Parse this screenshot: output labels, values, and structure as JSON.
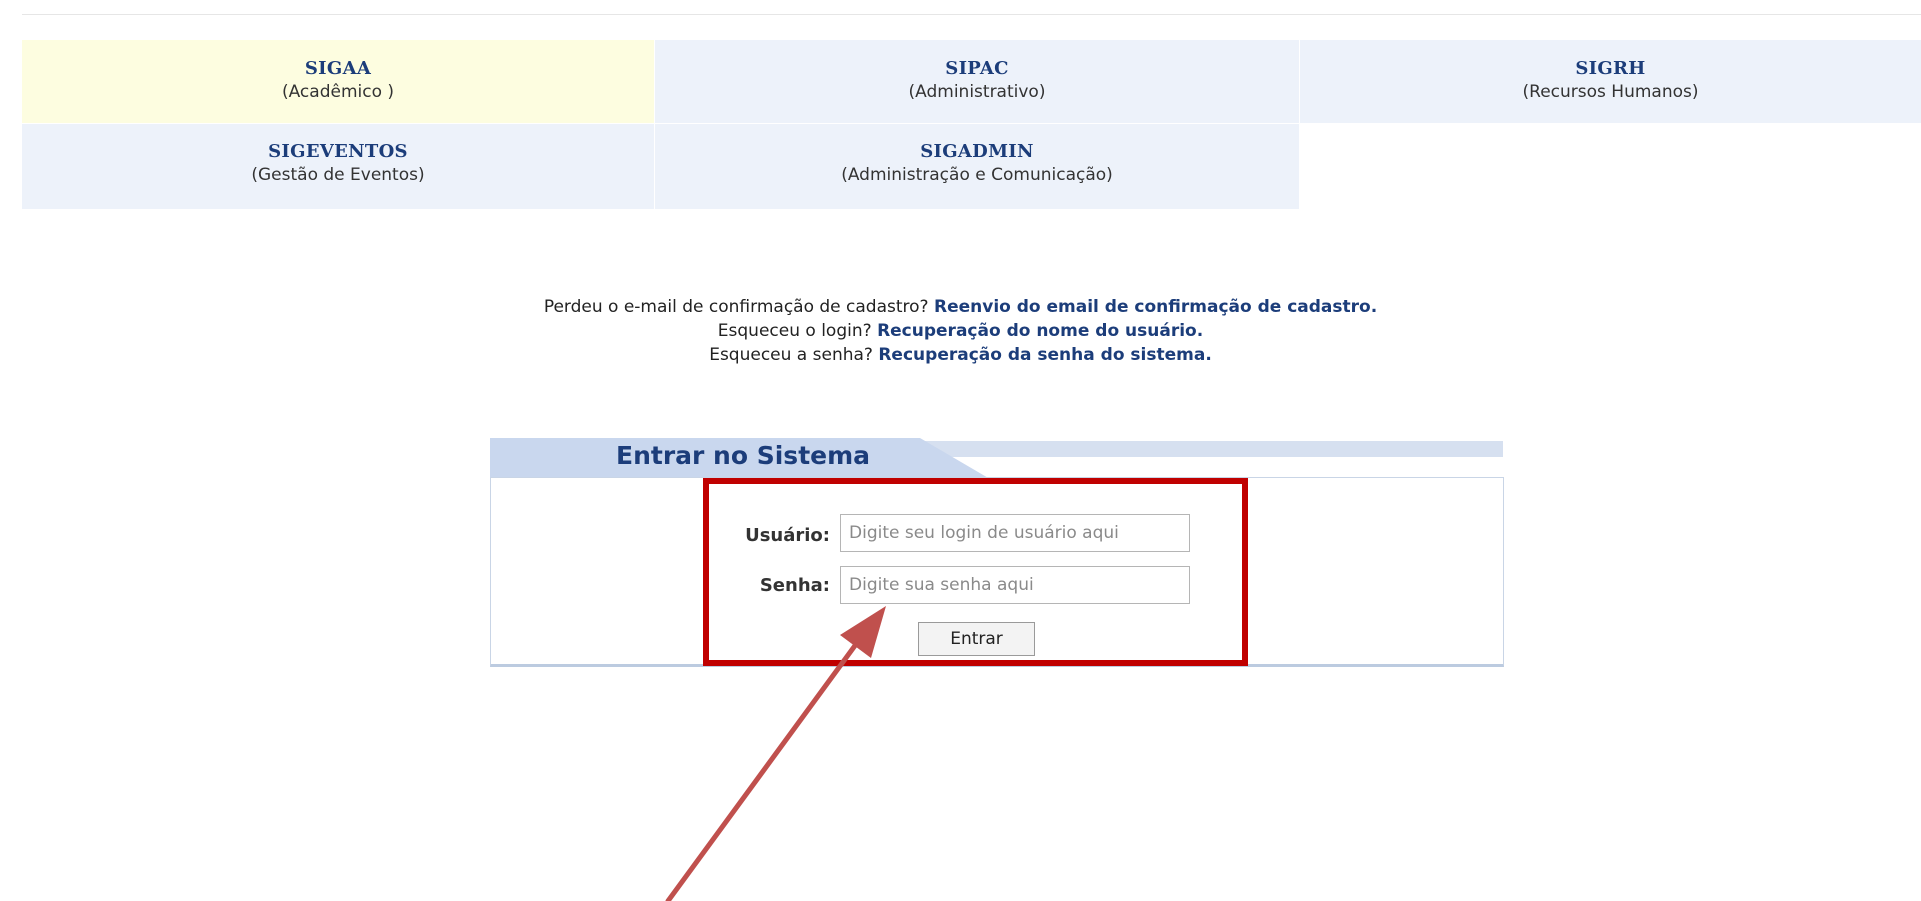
{
  "systems": [
    {
      "name": "SIGAA",
      "subtitle": "(Acadêmico )"
    },
    {
      "name": "SIPAC",
      "subtitle": "(Administrativo)"
    },
    {
      "name": "SIGRH",
      "subtitle": "(Recursos Humanos)"
    },
    {
      "name": "SIGEVENTOS",
      "subtitle": "(Gestão de Eventos)"
    },
    {
      "name": "SIGADMIN",
      "subtitle": "(Administração e Comunicação)"
    }
  ],
  "help": {
    "line1_text": "Perdeu o e-mail de confirmação de cadastro? ",
    "line1_link": "Reenvio do email de confirmação de cadastro.",
    "line2_text": "Esqueceu o login? ",
    "line2_link": "Recuperação do nome do usuário.",
    "line3_text": "Esqueceu a senha? ",
    "line3_link": "Recuperação da senha do sistema."
  },
  "login": {
    "title": "Entrar no Sistema",
    "user_label": "Usuário:",
    "user_placeholder": "Digite seu login de usuário aqui",
    "password_label": "Senha:",
    "password_placeholder": "Digite sua senha aqui",
    "submit_label": "Entrar"
  },
  "colors": {
    "highlight_box": "#c00000",
    "arrow": "#c0504d",
    "sigaa_cell": "#fdfde0",
    "system_cell": "#edf2fa",
    "link": "#1c3d7a"
  },
  "annotation": {
    "highlight_icon": "red-highlight-rectangle",
    "arrow_icon": "red-pointer-arrow"
  }
}
